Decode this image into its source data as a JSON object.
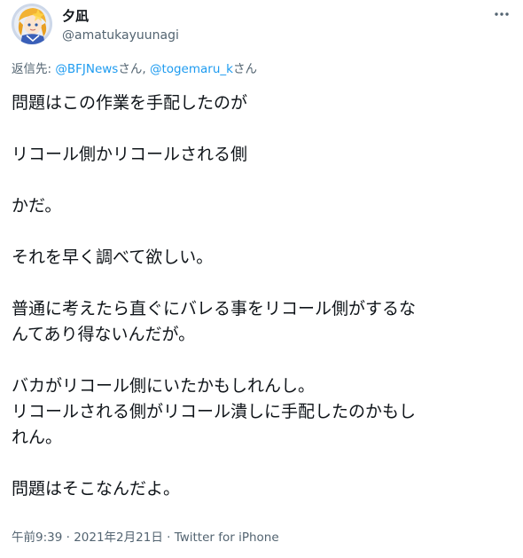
{
  "author": {
    "name": "夕凪",
    "handle": "@amatukayuunagi"
  },
  "reply": {
    "prefix": "返信先: ",
    "mention1": "@BFJNews",
    "suffix1": "さん, ",
    "mention2": "@togemaru_k",
    "suffix2": "さん"
  },
  "body": {
    "line1": "問題はこの作業を手配したのが",
    "line2": "リコール側かリコールされる側",
    "line3": "かだ。",
    "line4": "それを早く調べて欲しい。",
    "line5a": "普通に考えたら直ぐにバレる事をリコール側がするな",
    "line5b": "んてあり得ないんだが。",
    "line6a": "バカがリコール側にいたかもしれんし。",
    "line6b": "リコールされる側がリコール潰しに手配したのかもし",
    "line6c": "れん。",
    "line7": "問題はそこなんだよ。"
  },
  "meta": {
    "time": "午前9:39",
    "separator1": " · ",
    "date": "2021年2月21日",
    "separator2": " · ",
    "source": "Twitter for iPhone"
  },
  "colors": {
    "link": "#1d9bf0",
    "secondary": "#536471",
    "text": "#0f1419"
  },
  "icons": {
    "more": "more-icon"
  }
}
